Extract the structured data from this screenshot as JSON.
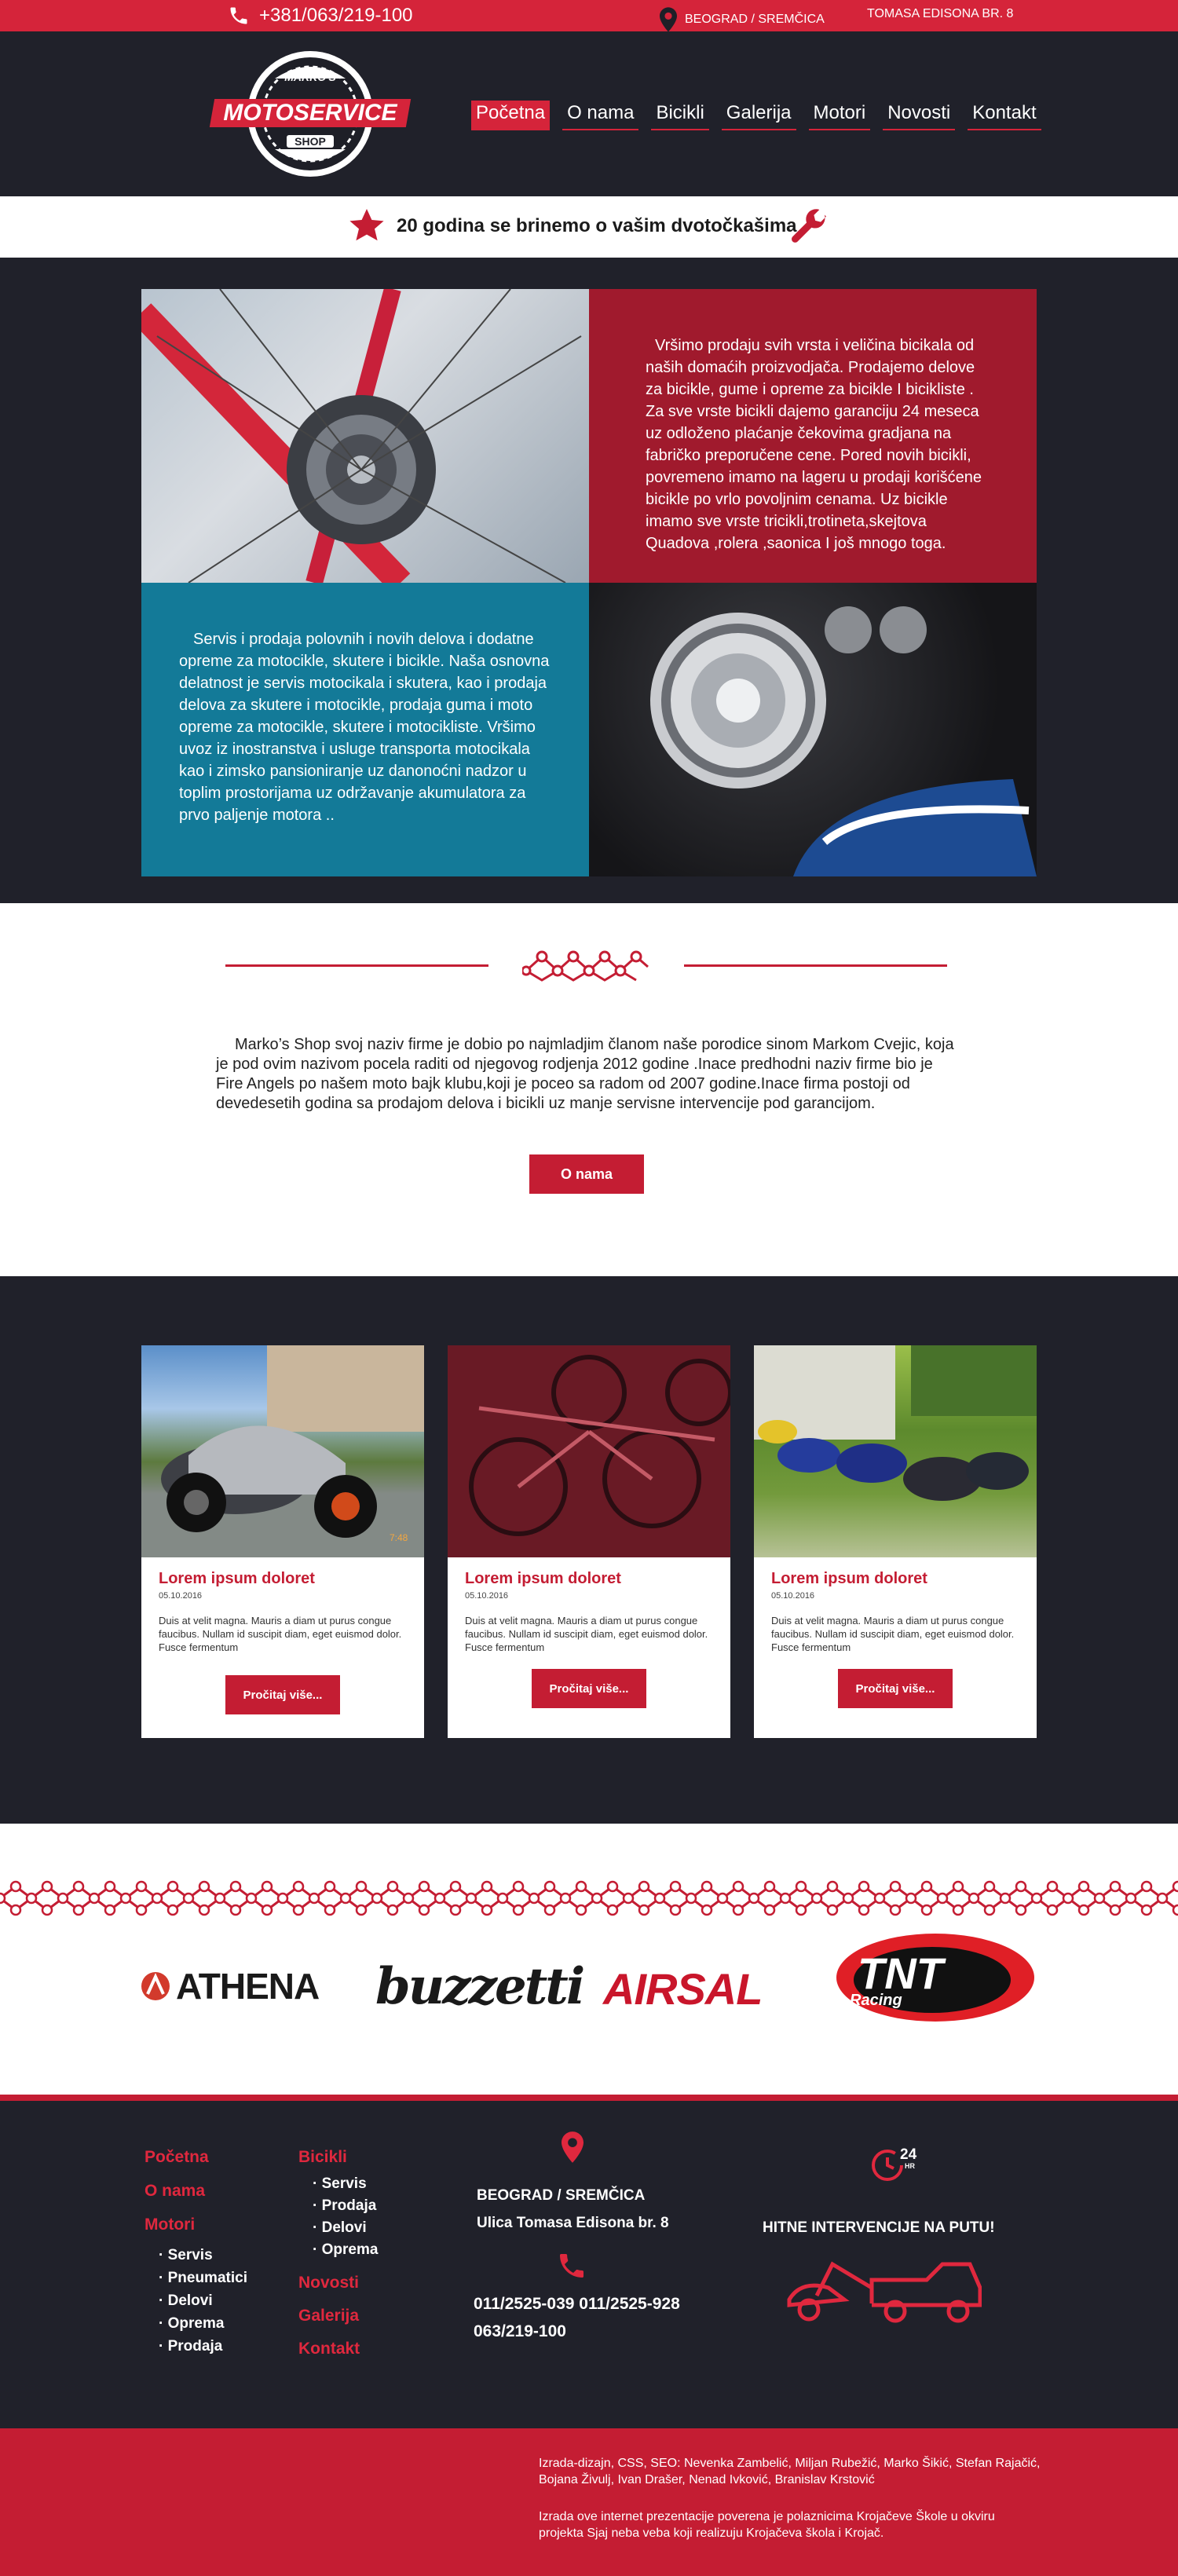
{
  "topbar": {
    "phone": "+381/063/219-100",
    "location": "BEOGRAD / SREMČICA",
    "street": "TOMASA EDISONA BR. 8"
  },
  "logo": {
    "top": "MARKO'S",
    "main": "MOTOSERVICE",
    "bottom": "SHOP"
  },
  "nav": [
    "Početna",
    "O nama",
    "Bicikli",
    "Galerija",
    "Motori",
    "Novosti",
    "Kontakt"
  ],
  "tagline": "20 godina se brinemo o vašim dvotočkašima",
  "features": {
    "text1": "Vršimo prodaju svih vrsta i veličina  bicikala od naših domaćih proizvodjača. Prodajemo delove za bicikle, gume  i opreme za bicikle I biciklistе . Za sve vrste bicikli dajemo garanciju 24 meseca uz odloženo plaćanje čekovima gradjana na fabričko preporučene cene. Pored novih bicikli, povremeno imamo na lageru u prodaji korišćene bicikle po vrlo povoljnim cenama. Uz bicikle imamo sve vrste tricikli,trotineta,skejtova Quadova ,rolera ,saonica I još mnogo toga.",
    "text2": "Servis i prodaja polovnih i novih delova i dodatne opreme za motocikle, skutere i bicikle. Naša osnovna delatnost je servis motocikala i skutera, kao i prodaja delova za skutere i motocikle, prodaja guma i moto opreme za motocikle, skutere i motocikliste. Vršimo uvoz iz inostranstva i usluge transporta  motocikala kao i zimsko pansioniranje uz danonoćni nadzor u toplim prostorijama uz održavanje akumulatora za prvo paljenje motora .."
  },
  "about": {
    "text": "Marko’s Shop svoj naziv firme je dobio po najmladjim članom naše porodice sinom Markom Cvejic, koja je pod ovim nazivom pocela raditi od njegovog rodjenja 2012 godine .Inace predhodni naziv firme bio je Fire Angels po našem moto bajk klubu,koji je poceo sa radom od 2007 godine.Inace firma postoji od devedesetih godina sa prodajom delova i bicikli uz manje servisne intervencije pod garancijom.",
    "button": "O nama"
  },
  "news": [
    {
      "title": "Lorem ipsum doloret",
      "date": "05.10.2016",
      "body": "Duis at velit magna. Mauris a diam ut purus congue faucibus. Nullam id suscipit diam, eget euismod dolor. Fusce fermentum",
      "button": "Pročitaj više...",
      "photo_stamp": "7:48"
    },
    {
      "title": "Lorem ipsum doloret",
      "date": "05.10.2016",
      "body": "Duis at velit magna. Mauris a diam ut purus congue faucibus. Nullam id suscipit diam, eget euismod dolor. Fusce fermentum",
      "button": "Pročitaj više..."
    },
    {
      "title": "Lorem ipsum doloret",
      "date": "05.10.2016",
      "body": "Duis at velit magna. Mauris a diam ut purus congue faucibus. Nullam id suscipit diam, eget euismod dolor. Fusce fermentum",
      "button": "Pročitaj više..."
    }
  ],
  "partners": [
    "ATHENA",
    "buzzetti",
    "AIRSAL",
    "TNT",
    "Racing"
  ],
  "footer": {
    "col1": {
      "pocetna": "Početna",
      "onama": "O nama",
      "motori": "Motori",
      "sub": [
        "· Servis",
        "· Pneumatici",
        "· Delovi",
        "· Oprema",
        "· Prodaja"
      ]
    },
    "col2": {
      "bicikli": "Bicikli",
      "sub": [
        "· Servis",
        "· Prodaja",
        "· Delovi",
        "· Oprema"
      ],
      "novosti": "Novosti",
      "galerija": "Galerija",
      "kontakt": "Kontakt"
    },
    "address_line1": "BEOGRAD / SREMČICA",
    "address_line2": "Ulica Tomasa Edisona br. 8",
    "phones_line1": "011/2525-039  011/2525-928",
    "phones_line2": "063/219-100",
    "badge_24": "24",
    "badge_hr": "HR",
    "emergency": "HITNE INTERVENCIJE NA PUTU!"
  },
  "bottombar": {
    "credits": "Izrada-dizajn, CSS, SEO: Nevenka Zambelić, Miljan Rubežić, Marko Šikić, Stefan Rajačić, Bojana Živulj, Ivan Drašer, Nenad Ivković, Branislav Krstović",
    "note": "Izrada ove internet prezentacije poverena je polaznicima Krojačeve Škole u okviru projekta Sjaj neba veba koji realizuju Krojačeva škola i Krojač."
  },
  "colors": {
    "accent": "#d5243a",
    "dark": "#20212a",
    "teal": "#137a98",
    "wine": "#a01a2d"
  }
}
